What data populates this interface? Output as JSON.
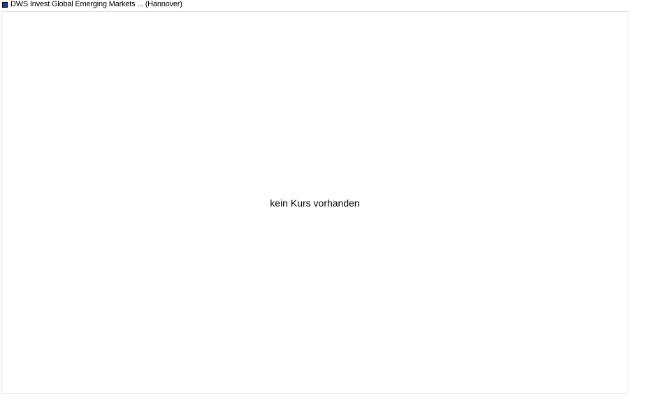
{
  "chart_data": {
    "type": "line",
    "series": [
      {
        "name": "DWS Invest Global Emerging Markets ... (Hannover)",
        "color": "#1f3f99",
        "values": []
      }
    ],
    "annotations": [
      "kein Kurs vorhanden"
    ],
    "legend_placement": "top-left",
    "grid": false
  }
}
